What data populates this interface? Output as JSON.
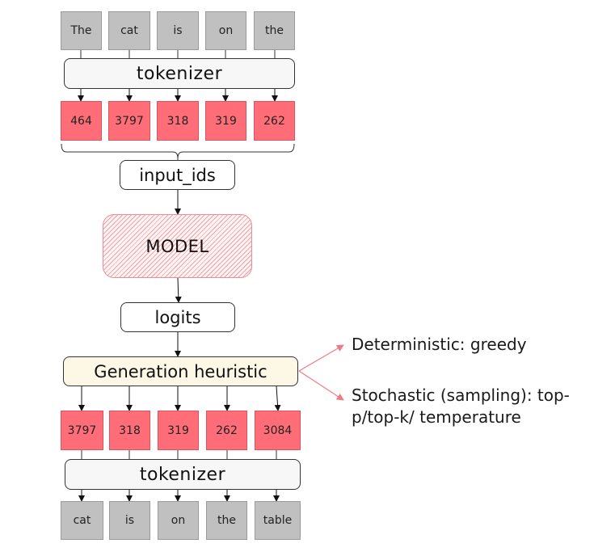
{
  "input_tokens": [
    "The",
    "cat",
    "is",
    "on",
    "the"
  ],
  "input_ids": [
    "464",
    "3797",
    "318",
    "319",
    "262"
  ],
  "tokenizer_label": "tokenizer",
  "input_ids_label": "input_ids",
  "model_label": "MODEL",
  "logits_label": "logits",
  "generation_label": "Generation heuristic",
  "output_ids": [
    "3797",
    "318",
    "319",
    "262",
    "3084"
  ],
  "output_tokens": [
    "cat",
    "is",
    "on",
    "the",
    "table"
  ],
  "strategies": {
    "deterministic": "Deterministic: greedy",
    "stochastic_line1": "Stochastic (sampling): top-",
    "stochastic_line2": "p/top-k/ temperature"
  },
  "colors": {
    "token_word": "#c0c0c0",
    "token_id": "#ff6e78",
    "model_hatch": "#f5a1a8",
    "generation_fill": "#fdf7e6",
    "strategy_arrow": "#f27a84"
  }
}
